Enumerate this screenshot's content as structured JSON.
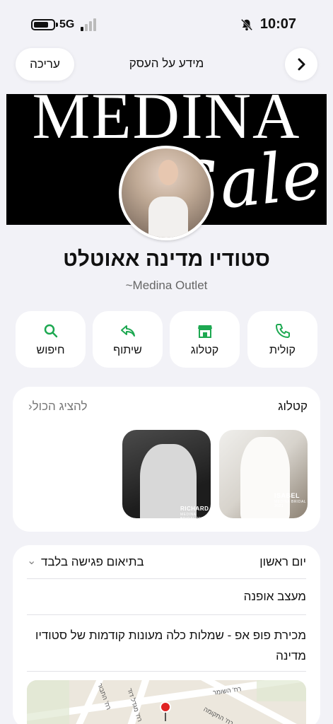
{
  "status_bar": {
    "network": "5G",
    "time": "10:07"
  },
  "header": {
    "edit_label": "עריכה",
    "title": "מידע על העסק"
  },
  "cover": {
    "title_text": "MEDINA",
    "script_text": "Sale"
  },
  "business": {
    "name": "סטודיו מדינה אאוטלט",
    "subtitle": "~Medina Outlet"
  },
  "actions": [
    {
      "label": "קולית",
      "icon": "phone-icon"
    },
    {
      "label": "קטלוג",
      "icon": "store-icon"
    },
    {
      "label": "שיתוף",
      "icon": "share-icon"
    },
    {
      "label": "חיפוש",
      "icon": "search-icon"
    }
  ],
  "catalog": {
    "title": "קטלוג",
    "show_all": "להציג הכול",
    "items": [
      {
        "tag": "ISABEL",
        "sub": "MEDINA BRIDAL 2021"
      },
      {
        "tag": "RICHARD",
        "sub": "MEDINA BRIDAL 2021"
      }
    ]
  },
  "info": {
    "hours_day": "יום ראשון",
    "hours_value": "בתיאום פגישה בלבד",
    "category": "מעצב אופנה",
    "description": "מכירת פופ אפ - שמלות כלה מעונות קודמות של סטודיו מדינה",
    "map_streets": [
      "רח' השומר",
      "רח' התבור",
      "רח' מגדל דוד",
      "רח' התקומה"
    ]
  },
  "colors": {
    "accent": "#1da851",
    "background": "#f2f2f7",
    "card": "#ffffff"
  }
}
